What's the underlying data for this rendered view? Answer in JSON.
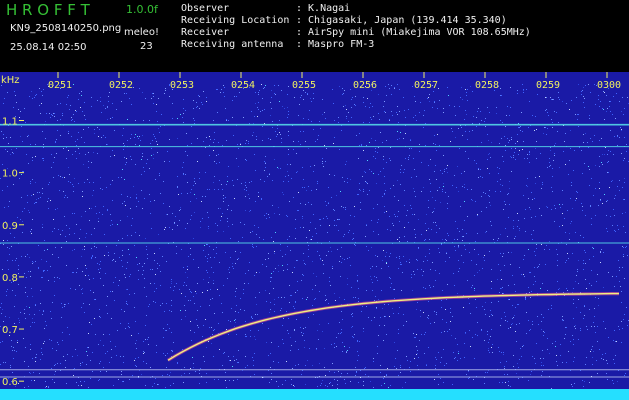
{
  "header": {
    "app_name": "H R O F F T",
    "version": "1.0.0f",
    "file_name": "KN9_2508140250.png",
    "program": "meleo!",
    "count": "23",
    "datetime": "25.08.14 02:50"
  },
  "info": [
    {
      "key": "Observer",
      "value": ": K.Nagai"
    },
    {
      "key": "Receiving Location",
      "value": ": Chigasaki, Japan (139.414 35.340)"
    },
    {
      "key": "Receiver",
      "value": ": AirSpy mini (Miakejima VOR 108.65MHz)"
    },
    {
      "key": "Receiving antenna",
      "value": ": Maspro FM-3"
    }
  ],
  "waterfall": {
    "y_unit": "kHz",
    "y_ticks": [
      "1.1",
      "1.0",
      "0.9",
      "0.8",
      "0.7",
      "0.6"
    ],
    "y_range_khz": [
      0.585,
      1.17
    ],
    "x_ticks": [
      "0251",
      "0252",
      "0253",
      "0254",
      "0255",
      "0256",
      "0257",
      "0258",
      "0259",
      "0300"
    ],
    "carrier_lines_khz": [
      1.092,
      1.05,
      0.865,
      0.622,
      0.608
    ],
    "meteor_head_echo": {
      "start_time": "02:52:45",
      "start_khz": 0.64,
      "end_khz": 0.77
    },
    "colors": {
      "background": "#1a1aa6",
      "noise": "#3f63ff",
      "carrier": "#55d9e8",
      "echo": "#f0f080",
      "bottom_band": "#25dfff",
      "ticks": "#f0f060"
    }
  }
}
